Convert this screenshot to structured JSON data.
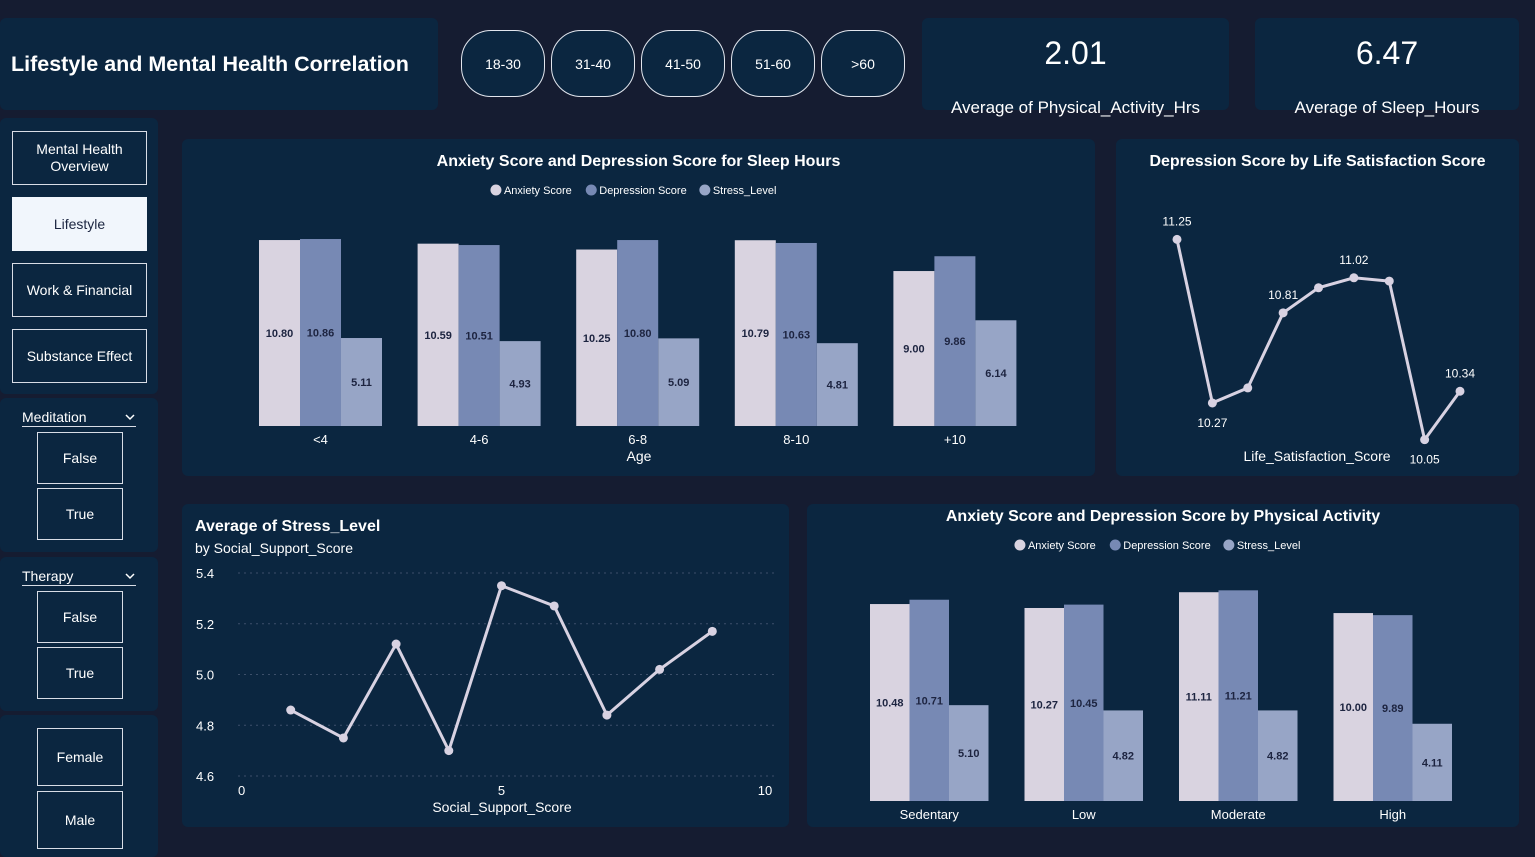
{
  "header": {
    "title": "Lifestyle and Mental Health Correlation",
    "age_buttons": [
      "18-30",
      "31-40",
      "41-50",
      "51-60",
      ">60"
    ],
    "kpis": [
      {
        "value": "2.01",
        "label": "Average of Physical_Activity_Hrs"
      },
      {
        "value": "6.47",
        "label": "Average of Sleep_Hours"
      }
    ]
  },
  "nav": {
    "items": [
      "Mental Health Overview",
      "Lifestyle",
      "Work & Financial",
      "Substance Effect"
    ],
    "active": "Lifestyle"
  },
  "slicers": {
    "meditation": {
      "title": "Meditation",
      "options": [
        "False",
        "True"
      ]
    },
    "therapy": {
      "title": "Therapy",
      "options": [
        "False",
        "True"
      ]
    },
    "gender": {
      "options": [
        "Female",
        "Male"
      ]
    }
  },
  "colors": {
    "background": "#151c31",
    "panel": "#0b2640",
    "anxiety": "#d9d3e0",
    "depression": "#7789b4",
    "stress": "#97a5c6",
    "line": "#d8d2e2"
  },
  "chart_data": [
    {
      "id": "sleep",
      "type": "bar",
      "title": "Anxiety Score and Depression Score for Sleep Hours",
      "xlabel": "Age",
      "categories": [
        "<4",
        "4-6",
        "6-8",
        "8-10",
        "+10"
      ],
      "series": [
        {
          "name": "Anxiety Score",
          "values": [
            10.8,
            10.59,
            10.25,
            10.79,
            9.0
          ]
        },
        {
          "name": "Depression Score",
          "values": [
            10.86,
            10.51,
            10.8,
            10.63,
            9.86
          ]
        },
        {
          "name": "Stress_Level",
          "values": [
            5.11,
            4.93,
            5.09,
            4.81,
            6.14
          ]
        }
      ],
      "data_labels": [
        [
          "10.80",
          "10.59",
          "10.25",
          "10.79",
          "9.00"
        ],
        [
          "10.86",
          "10.51",
          "10.80",
          "10.63",
          "9.86"
        ],
        [
          "5.11",
          "4.93",
          "5.09",
          "4.81",
          "6.14"
        ]
      ],
      "ylim": [
        0,
        11.5
      ],
      "legend": "top-center"
    },
    {
      "id": "lifesat",
      "type": "line",
      "title": "Depression Score by Life Satisfaction Score",
      "xlabel": "Life_Satisfaction_Score",
      "x": [
        1,
        2,
        3,
        4,
        5,
        6,
        7,
        8,
        9,
        10
      ],
      "values": [
        11.25,
        10.27,
        10.36,
        10.81,
        10.96,
        11.02,
        11.0,
        10.05,
        10.34
      ],
      "labels": [
        {
          "index": 0,
          "text": "11.25"
        },
        {
          "index": 1,
          "text": "10.27"
        },
        {
          "index": 3,
          "text": "10.81"
        },
        {
          "index": 5,
          "text": "11.02"
        },
        {
          "index": 7,
          "text": "10.05"
        },
        {
          "index": 8,
          "text": "10.34"
        }
      ],
      "ylim": [
        10.0,
        11.45
      ]
    },
    {
      "id": "social",
      "type": "line",
      "title": "Average of Stress_Level",
      "subtitle": "by Social_Support_Score",
      "xlabel": "Social_Support_Score",
      "x": [
        1,
        2,
        3,
        4,
        5,
        6,
        7,
        8,
        9
      ],
      "values": [
        4.86,
        4.75,
        5.12,
        4.7,
        5.35,
        5.27,
        4.84,
        5.02,
        5.17
      ],
      "xlim": [
        0,
        10
      ],
      "xticks": [
        "0",
        "5",
        "10"
      ],
      "ylim": [
        4.6,
        5.4
      ],
      "yticks": [
        "4.6",
        "4.8",
        "5.0",
        "5.2",
        "5.4"
      ],
      "grid": true
    },
    {
      "id": "physical",
      "type": "bar",
      "title": "Anxiety Score and Depression Score by Physical Activity",
      "categories": [
        "Sedentary",
        "Low",
        "Moderate",
        "High"
      ],
      "series": [
        {
          "name": "Anxiety Score",
          "values": [
            10.48,
            10.27,
            11.11,
            10.0
          ]
        },
        {
          "name": "Depression Score",
          "values": [
            10.71,
            10.45,
            11.21,
            9.89
          ]
        },
        {
          "name": "Stress_Level",
          "values": [
            5.1,
            4.82,
            4.82,
            4.11
          ]
        }
      ],
      "data_labels": [
        [
          "10.48",
          "10.27",
          "11.11",
          "10.00"
        ],
        [
          "10.71",
          "10.45",
          "11.21",
          "9.89"
        ],
        [
          "5.10",
          "4.82",
          "4.82",
          "4.11"
        ]
      ],
      "ylim": [
        0,
        11.6
      ],
      "legend": "top-center"
    }
  ]
}
